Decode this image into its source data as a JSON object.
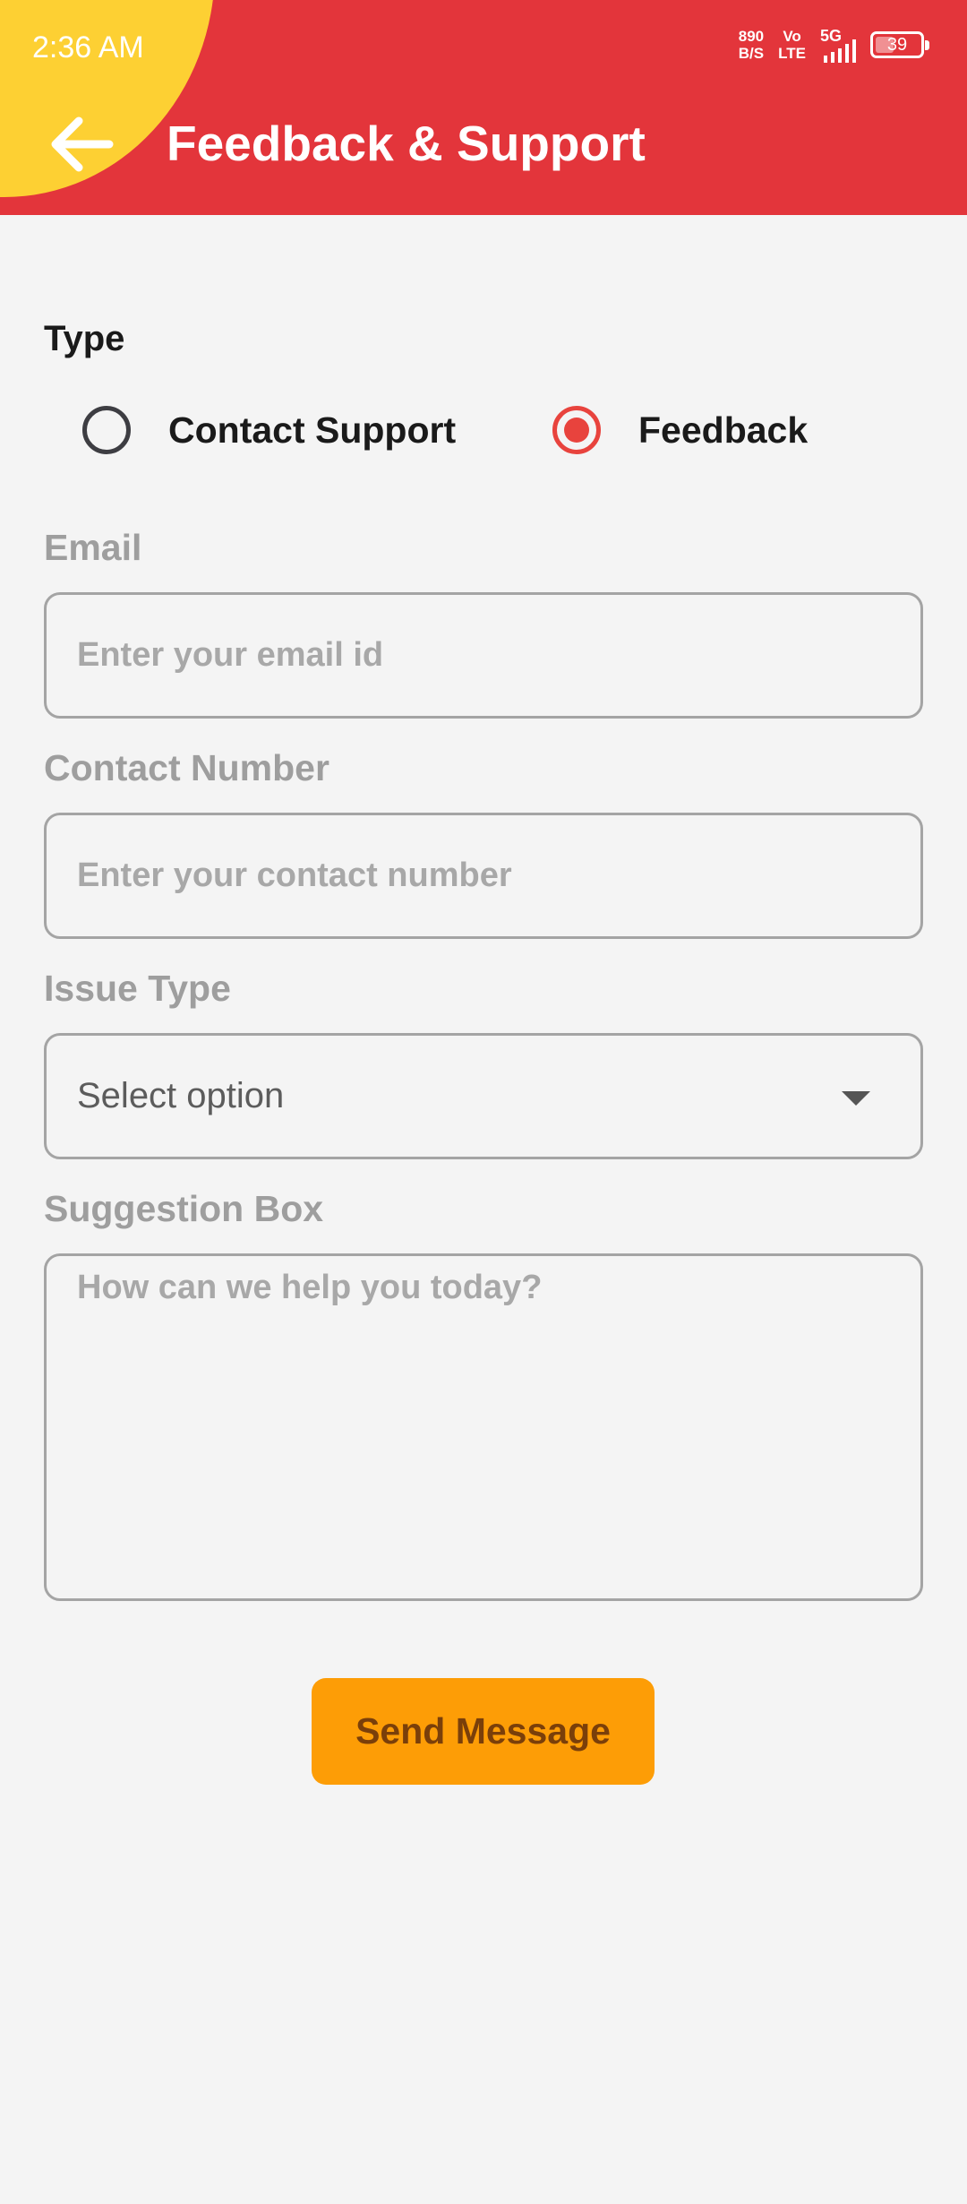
{
  "status_bar": {
    "time": "2:36 AM",
    "net_speed_value": "890",
    "net_speed_unit": "B/S",
    "volte_top": "Vo",
    "volte_bottom": "LTE",
    "network": "5G",
    "battery": "39"
  },
  "header": {
    "title": "Feedback & Support",
    "back_icon": "arrow-left-icon",
    "colors": {
      "background": "#e3353b",
      "accent_blob": "#fdd033"
    }
  },
  "form": {
    "type_label": "Type",
    "radio_options": [
      {
        "label": "Contact Support",
        "selected": false
      },
      {
        "label": "Feedback",
        "selected": true
      }
    ],
    "email": {
      "label": "Email",
      "placeholder": "Enter your email id"
    },
    "contact": {
      "label": "Contact Number",
      "placeholder": "Enter your contact number"
    },
    "issue_type": {
      "label": "Issue Type",
      "selected_value": "Select option"
    },
    "suggestion": {
      "label": "Suggestion Box",
      "placeholder": "How can we help you today?"
    },
    "submit_label": "Send Message",
    "colors": {
      "radio_selected": "#e8433d",
      "button": "#fd9d06",
      "button_text": "#7a3f0a"
    }
  }
}
